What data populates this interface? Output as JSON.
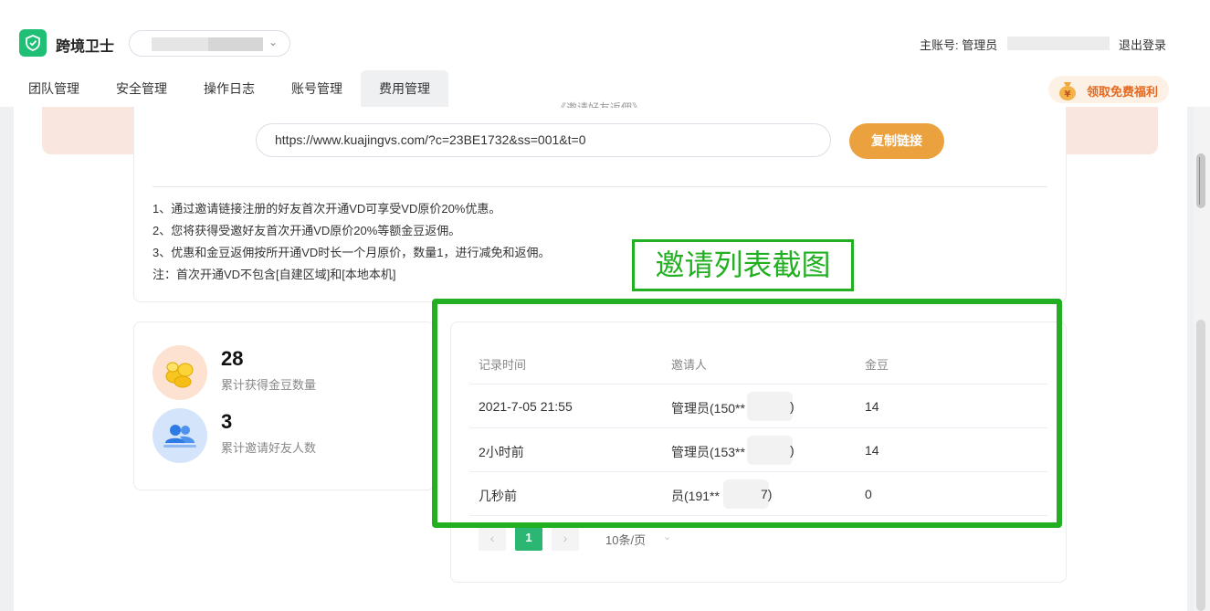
{
  "header": {
    "brand": "跨境卫士",
    "account_label": "主账号: 管理员",
    "logout": "退出登录",
    "benefit": "领取免费福利"
  },
  "tabs": [
    "团队管理",
    "安全管理",
    "操作日志",
    "账号管理",
    "费用管理"
  ],
  "active_tab": "费用管理",
  "invite": {
    "partial_title": "《邀请好友返佣》",
    "link": "https://www.kuajingvs.com/?c=23BE1732&ss=001&t=0",
    "copy_button": "复制链接",
    "rules": [
      "1、通过邀请链接注册的好友首次开通VD可享受VD原价20%优惠。",
      "2、您将获得受邀好友首次开通VD原价20%等额金豆返佣。",
      "3、优惠和金豆返佣按所开通VD时长一个月原价，数量1，进行减免和返佣。",
      "注：首次开通VD不包含[自建区域]和[本地本机]"
    ]
  },
  "stats": {
    "beans_value": "28",
    "beans_label": "累计获得金豆数量",
    "friends_value": "3",
    "friends_label": "累计邀请好友人数"
  },
  "table": {
    "headers": [
      "记录时间",
      "邀请人",
      "金豆"
    ],
    "rows": [
      {
        "time": "2021-7-05 21:55",
        "inviter_prefix": "管理员(150**",
        "inviter_suffix": ")",
        "beans": "14"
      },
      {
        "time": "2小时前",
        "inviter_prefix": "管理员(153**",
        "inviter_suffix": ")",
        "beans": "14"
      },
      {
        "time": "几秒前",
        "inviter_prefix": "员(191**",
        "inviter_suffix": "7)",
        "beans": "0"
      }
    ]
  },
  "pagination": {
    "prev": "‹",
    "current": "1",
    "next": "›",
    "page_size": "10条/页"
  },
  "annotation": {
    "label": "邀请列表截图"
  },
  "colors": {
    "brand_green": "#1fbf75",
    "annotation_green": "#22b022",
    "copy_button": "#eba23e",
    "pagination_active": "#2bb673"
  }
}
